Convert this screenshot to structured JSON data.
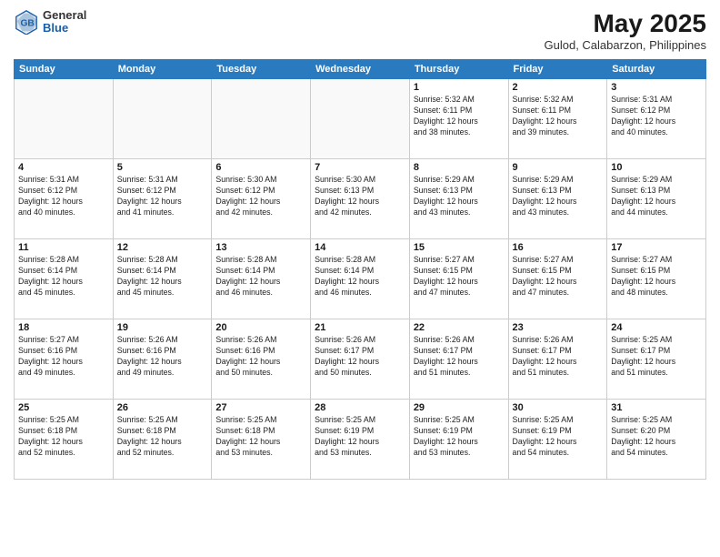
{
  "header": {
    "logo": {
      "general": "General",
      "blue": "Blue"
    },
    "title": "May 2025",
    "subtitle": "Gulod, Calabarzon, Philippines"
  },
  "days_of_week": [
    "Sunday",
    "Monday",
    "Tuesday",
    "Wednesday",
    "Thursday",
    "Friday",
    "Saturday"
  ],
  "weeks": [
    [
      {
        "day": "",
        "info": ""
      },
      {
        "day": "",
        "info": ""
      },
      {
        "day": "",
        "info": ""
      },
      {
        "day": "",
        "info": ""
      },
      {
        "day": "1",
        "info": "Sunrise: 5:32 AM\nSunset: 6:11 PM\nDaylight: 12 hours\nand 38 minutes."
      },
      {
        "day": "2",
        "info": "Sunrise: 5:32 AM\nSunset: 6:11 PM\nDaylight: 12 hours\nand 39 minutes."
      },
      {
        "day": "3",
        "info": "Sunrise: 5:31 AM\nSunset: 6:12 PM\nDaylight: 12 hours\nand 40 minutes."
      }
    ],
    [
      {
        "day": "4",
        "info": "Sunrise: 5:31 AM\nSunset: 6:12 PM\nDaylight: 12 hours\nand 40 minutes."
      },
      {
        "day": "5",
        "info": "Sunrise: 5:31 AM\nSunset: 6:12 PM\nDaylight: 12 hours\nand 41 minutes."
      },
      {
        "day": "6",
        "info": "Sunrise: 5:30 AM\nSunset: 6:12 PM\nDaylight: 12 hours\nand 42 minutes."
      },
      {
        "day": "7",
        "info": "Sunrise: 5:30 AM\nSunset: 6:13 PM\nDaylight: 12 hours\nand 42 minutes."
      },
      {
        "day": "8",
        "info": "Sunrise: 5:29 AM\nSunset: 6:13 PM\nDaylight: 12 hours\nand 43 minutes."
      },
      {
        "day": "9",
        "info": "Sunrise: 5:29 AM\nSunset: 6:13 PM\nDaylight: 12 hours\nand 43 minutes."
      },
      {
        "day": "10",
        "info": "Sunrise: 5:29 AM\nSunset: 6:13 PM\nDaylight: 12 hours\nand 44 minutes."
      }
    ],
    [
      {
        "day": "11",
        "info": "Sunrise: 5:28 AM\nSunset: 6:14 PM\nDaylight: 12 hours\nand 45 minutes."
      },
      {
        "day": "12",
        "info": "Sunrise: 5:28 AM\nSunset: 6:14 PM\nDaylight: 12 hours\nand 45 minutes."
      },
      {
        "day": "13",
        "info": "Sunrise: 5:28 AM\nSunset: 6:14 PM\nDaylight: 12 hours\nand 46 minutes."
      },
      {
        "day": "14",
        "info": "Sunrise: 5:28 AM\nSunset: 6:14 PM\nDaylight: 12 hours\nand 46 minutes."
      },
      {
        "day": "15",
        "info": "Sunrise: 5:27 AM\nSunset: 6:15 PM\nDaylight: 12 hours\nand 47 minutes."
      },
      {
        "day": "16",
        "info": "Sunrise: 5:27 AM\nSunset: 6:15 PM\nDaylight: 12 hours\nand 47 minutes."
      },
      {
        "day": "17",
        "info": "Sunrise: 5:27 AM\nSunset: 6:15 PM\nDaylight: 12 hours\nand 48 minutes."
      }
    ],
    [
      {
        "day": "18",
        "info": "Sunrise: 5:27 AM\nSunset: 6:16 PM\nDaylight: 12 hours\nand 49 minutes."
      },
      {
        "day": "19",
        "info": "Sunrise: 5:26 AM\nSunset: 6:16 PM\nDaylight: 12 hours\nand 49 minutes."
      },
      {
        "day": "20",
        "info": "Sunrise: 5:26 AM\nSunset: 6:16 PM\nDaylight: 12 hours\nand 50 minutes."
      },
      {
        "day": "21",
        "info": "Sunrise: 5:26 AM\nSunset: 6:17 PM\nDaylight: 12 hours\nand 50 minutes."
      },
      {
        "day": "22",
        "info": "Sunrise: 5:26 AM\nSunset: 6:17 PM\nDaylight: 12 hours\nand 51 minutes."
      },
      {
        "day": "23",
        "info": "Sunrise: 5:26 AM\nSunset: 6:17 PM\nDaylight: 12 hours\nand 51 minutes."
      },
      {
        "day": "24",
        "info": "Sunrise: 5:25 AM\nSunset: 6:17 PM\nDaylight: 12 hours\nand 51 minutes."
      }
    ],
    [
      {
        "day": "25",
        "info": "Sunrise: 5:25 AM\nSunset: 6:18 PM\nDaylight: 12 hours\nand 52 minutes."
      },
      {
        "day": "26",
        "info": "Sunrise: 5:25 AM\nSunset: 6:18 PM\nDaylight: 12 hours\nand 52 minutes."
      },
      {
        "day": "27",
        "info": "Sunrise: 5:25 AM\nSunset: 6:18 PM\nDaylight: 12 hours\nand 53 minutes."
      },
      {
        "day": "28",
        "info": "Sunrise: 5:25 AM\nSunset: 6:19 PM\nDaylight: 12 hours\nand 53 minutes."
      },
      {
        "day": "29",
        "info": "Sunrise: 5:25 AM\nSunset: 6:19 PM\nDaylight: 12 hours\nand 53 minutes."
      },
      {
        "day": "30",
        "info": "Sunrise: 5:25 AM\nSunset: 6:19 PM\nDaylight: 12 hours\nand 54 minutes."
      },
      {
        "day": "31",
        "info": "Sunrise: 5:25 AM\nSunset: 6:20 PM\nDaylight: 12 hours\nand 54 minutes."
      }
    ]
  ]
}
